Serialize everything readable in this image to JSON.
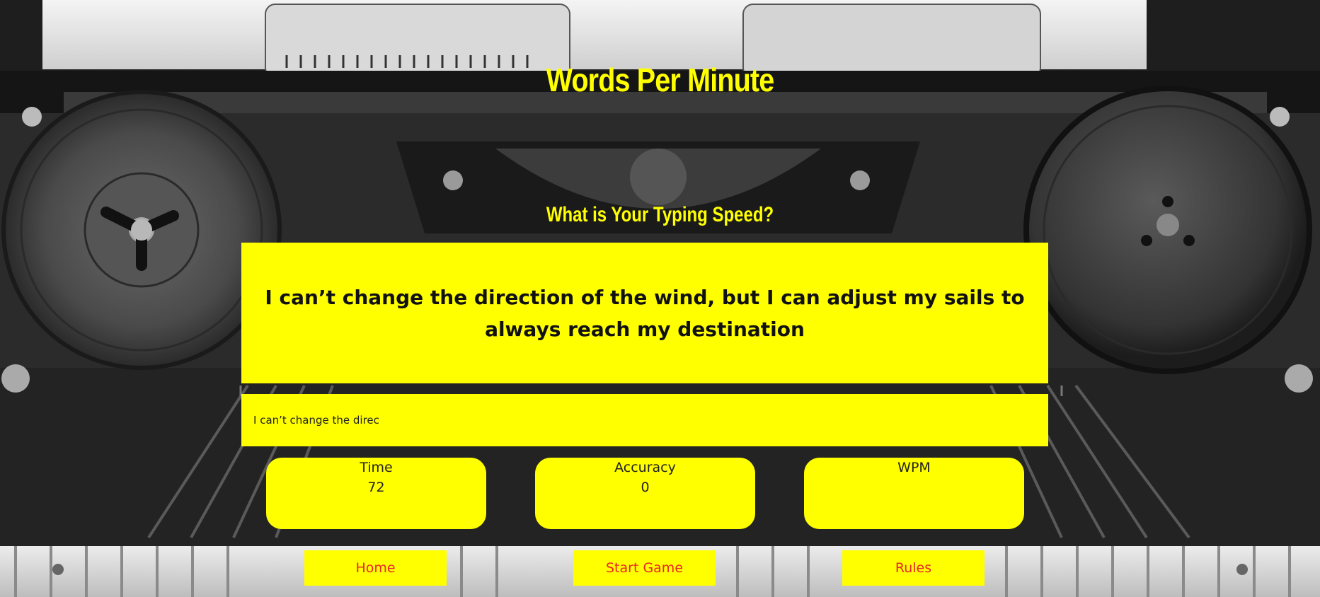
{
  "app": {
    "title": "Words Per Minute",
    "subtitle": "What is Your Typing Speed?"
  },
  "quote": {
    "text": "I can’t change the direction of the wind, but I can adjust my sails to always reach my destination"
  },
  "typing": {
    "value": "I can’t change the direc"
  },
  "stats": {
    "time_label": "Time",
    "time_value": "72",
    "accuracy_label": "Accuracy",
    "accuracy_value": "0",
    "wpm_label": "WPM",
    "wpm_value": ""
  },
  "nav": {
    "home_label": "Home",
    "start_label": "Start Game",
    "rules_label": "Rules"
  },
  "colors": {
    "accent": "#ffff00",
    "button_text": "#e8262a",
    "body_text": "#111111"
  }
}
